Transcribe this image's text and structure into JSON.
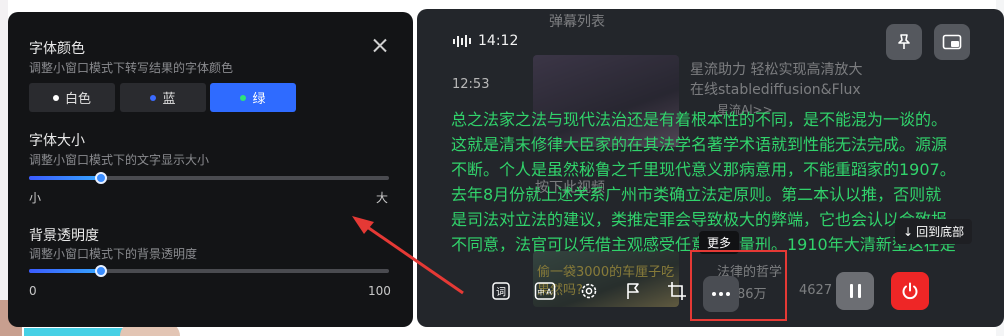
{
  "settings": {
    "font_color": {
      "title": "字体颜色",
      "desc": "调整小窗口模式下转写结果的字体颜色",
      "options": [
        {
          "label": "白色",
          "dot": "#ffffff"
        },
        {
          "label": "蓝",
          "dot": "#3b6bff"
        },
        {
          "label": "绿",
          "dot": "#2ee37a"
        }
      ],
      "selected": "绿"
    },
    "font_size": {
      "title": "字体大小",
      "desc": "调整小窗口模式下的文字显示大小",
      "min_label": "小",
      "max_label": "大",
      "level": 0.2
    },
    "opacity": {
      "title": "背景透明度",
      "desc": "调整小窗口模式下的背景透明度",
      "min_label": "0",
      "max_label": "100",
      "value": 20
    }
  },
  "underlying": {
    "danmaku_title": "弹幕列表",
    "video_title_1": "星流助力 轻松实现高清放大",
    "video_title_2": "在线stablediffusion&Flux",
    "tag": "星流Al>>",
    "overlay_1": "按下此视频",
    "overlay_2": "偷一袋3000的车厘子吃",
    "overlay_3": "果然吗?",
    "uploader": "法律的哲学",
    "stats": "86万",
    "stats_2": "4627"
  },
  "player": {
    "time": "14:12",
    "timestamp": "12:53",
    "subtitle_lines": [
      "总之法家之法与现代法治还是有着根本性的不同，是不能混为一谈的。",
      "这就是清末修律大臣家的在其法学名著学术语就到性能无法完成。源源",
      "不断。个人是虽然秘鲁之千里现代意义那病意用，不能重蹈家的1907。",
      "去年8月份就上述关系广州市类确立法定原则。第二本认以推，否则就",
      "是司法对立法的建议，类推定罪会导致极大的弊端，它也会认以会致报",
      "不同意，法官可以凭借主观感受任意定罪量刑。1910年大清新型这在是"
    ],
    "back_to_bottom": "回到底部",
    "more_tooltip": "更多",
    "tools": [
      "word-icon",
      "translate-icon",
      "settings-icon",
      "flag-icon",
      "crop-icon"
    ],
    "accent_green": "#31d36b",
    "stop_color": "#ee2626"
  }
}
